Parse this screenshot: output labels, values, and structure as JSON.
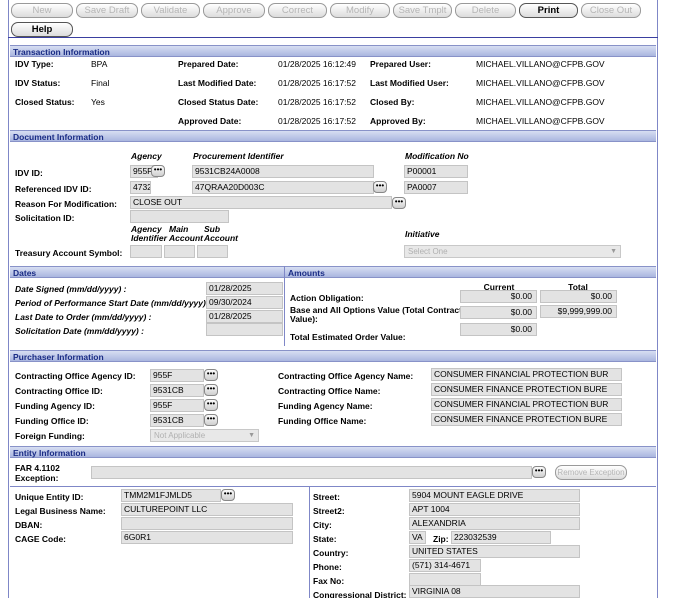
{
  "toolbar": {
    "new": "New",
    "save_draft": "Save Draft",
    "validate": "Validate",
    "approve": "Approve",
    "correct": "Correct",
    "modify": "Modify",
    "save_tmplt": "Save Tmplt",
    "delete": "Delete",
    "print": "Print",
    "close_out": "Close Out",
    "help": "Help"
  },
  "transaction": {
    "title": "Transaction Information",
    "idv_type_label": "IDV Type:",
    "idv_type": "BPA",
    "idv_status_label": "IDV Status:",
    "idv_status": "Final",
    "closed_status_label": "Closed Status:",
    "closed_status": "Yes",
    "prepared_date_label": "Prepared Date:",
    "prepared_date": "01/28/2025 16:12:49",
    "last_modified_date_label": "Last Modified Date:",
    "last_modified_date": "01/28/2025 16:17:52",
    "closed_status_date_label": "Closed Status Date:",
    "closed_status_date": "01/28/2025 16:17:52",
    "approved_date_label": "Approved Date:",
    "approved_date": "01/28/2025 16:17:52",
    "prepared_user_label": "Prepared User:",
    "prepared_user": "MICHAEL.VILLANO@CFPB.GOV",
    "last_modified_user_label": "Last Modified User:",
    "last_modified_user": "MICHAEL.VILLANO@CFPB.GOV",
    "closed_by_label": "Closed By:",
    "closed_by": "MICHAEL.VILLANO@CFPB.GOV",
    "approved_by_label": "Approved By:",
    "approved_by": "MICHAEL.VILLANO@CFPB.GOV"
  },
  "document": {
    "title": "Document Information",
    "agency_hdr": "Agency",
    "procurement_hdr": "Procurement Identifier",
    "modification_hdr": "Modification No",
    "idv_id_label": "IDV ID:",
    "idv_agency": "955F",
    "idv_proc_id": "9531CB24A0008",
    "idv_mod": "P00001",
    "ref_idv_label": "Referenced IDV ID:",
    "ref_agency": "4732",
    "ref_proc_id": "47QRAA20D003C",
    "ref_mod": "PA0007",
    "reason_label": "Reason For Modification:",
    "reason": "CLOSE OUT",
    "solicitation_label": "Solicitation ID:",
    "solicitation": "",
    "agency_identifier_hdr1": "Agency",
    "agency_identifier_hdr2": "Identifier",
    "main_account_hdr1": "Main",
    "main_account_hdr2": "Account",
    "sub_account_hdr1": "Sub",
    "sub_account_hdr2": "Account",
    "initiative_hdr": "Initiative",
    "treasury_label": "Treasury Account Symbol:",
    "initiative_select": "Select One"
  },
  "dates": {
    "title": "Dates",
    "signed_label": "Date Signed (mm/dd/yyyy) :",
    "signed": "01/28/2025",
    "pop_start_label": "Period of Performance Start Date (mm/dd/yyyy) :",
    "pop_start": "09/30/2024",
    "last_order_label": "Last Date to Order (mm/dd/yyyy) :",
    "last_order": "01/28/2025",
    "solicitation_date_label": "Solicitation Date (mm/dd/yyyy) :",
    "solicitation_date": ""
  },
  "amounts": {
    "title": "Amounts",
    "current_hdr": "Current",
    "total_hdr": "Total",
    "action_label": "Action Obligation:",
    "action_current": "$0.00",
    "action_total": "$0.00",
    "base_label_1": "Base and All Options Value (Total Contract",
    "base_label_2": "Value):",
    "base_current": "$0.00",
    "base_total": "$9,999,999.00",
    "est_label": "Total Estimated Order Value:",
    "est_current": "$0.00"
  },
  "purchaser": {
    "title": "Purchaser Information",
    "co_agency_id_label": "Contracting Office Agency ID:",
    "co_agency_id": "955F",
    "co_id_label": "Contracting Office ID:",
    "co_id": "9531CB",
    "fa_id_label": "Funding Agency ID:",
    "fa_id": "955F",
    "fo_id_label": "Funding Office ID:",
    "fo_id": "9531CB",
    "foreign_label": "Foreign Funding:",
    "foreign_select": "Not Applicable",
    "co_agency_name_label": "Contracting Office Agency Name:",
    "co_agency_name": "CONSUMER FINANCIAL PROTECTION BUR",
    "co_name_label": "Contracting Office Name:",
    "co_name": "CONSUMER FINANCE PROTECTION BURE",
    "fa_name_label": "Funding Agency Name:",
    "fa_name": "CONSUMER FINANCIAL PROTECTION BUR",
    "fo_name_label": "Funding Office Name:",
    "fo_name": "CONSUMER FINANCE PROTECTION BURE"
  },
  "entity": {
    "title": "Entity Information",
    "far_label_1": "FAR 4.1102",
    "far_label_2": "Exception:",
    "far_value": "",
    "remove_exception": "Remove Exception",
    "uei_label": "Unique Entity ID:",
    "uei": "TMM2M1FJMLD5",
    "legal_name_label": "Legal Business Name:",
    "legal_name": "CULTUREPOINT LLC",
    "dban_label": "DBAN:",
    "dban": "",
    "cage_label": "CAGE Code:",
    "cage": "6G0R1",
    "street_label": "Street:",
    "street": "5904 MOUNT EAGLE DRIVE",
    "street2_label": "Street2:",
    "street2": "APT 1004",
    "city_label": "City:",
    "city": "ALEXANDRIA",
    "state_label": "State:",
    "state": "VA",
    "zip_label": "Zip:",
    "zip": "223032539",
    "country_label": "Country:",
    "country": "UNITED STATES",
    "phone_label": "Phone:",
    "phone": "(571) 314-4671",
    "fax_label": "Fax No:",
    "fax": "",
    "district_label": "Congressional District:",
    "district": "VIRGINIA 08"
  }
}
